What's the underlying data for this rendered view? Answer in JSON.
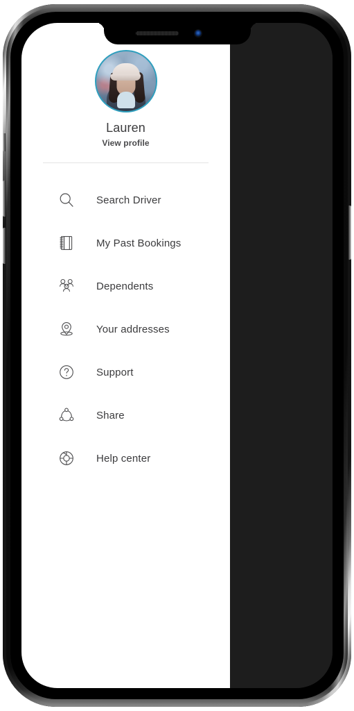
{
  "device": {
    "notch": {
      "speaker_icon": "speaker-grille-icon",
      "camera_icon": "front-camera-icon"
    },
    "buttons": {
      "silent_switch": "silent-switch",
      "volume_up": "volume-up-button",
      "volume_down": "volume-down-button",
      "power": "power-button"
    }
  },
  "drawer": {
    "profile": {
      "avatar_alt": "user-avatar-photo",
      "avatar_ring_color": "#2e9fbe",
      "name": "Lauren",
      "view_profile_label": "View profile"
    },
    "menu": [
      {
        "icon": "search-icon",
        "label": "Search Driver"
      },
      {
        "icon": "notebook-icon",
        "label": "My Past Bookings"
      },
      {
        "icon": "people-group-icon",
        "label": "Dependents"
      },
      {
        "icon": "map-pin-icon",
        "label": "Your addresses"
      },
      {
        "icon": "question-circle-icon",
        "label": "Support"
      },
      {
        "icon": "share-nodes-icon",
        "label": "Share"
      },
      {
        "icon": "lifebuoy-icon",
        "label": "Help center"
      }
    ]
  },
  "colors": {
    "panel_background": "#ffffff",
    "scrim_background": "#1d1d1d",
    "text_primary": "#3b3b3d",
    "text_secondary": "#4a4a4c",
    "icon_stroke": "#4d4d4f",
    "divider": "#e3e3e3"
  }
}
